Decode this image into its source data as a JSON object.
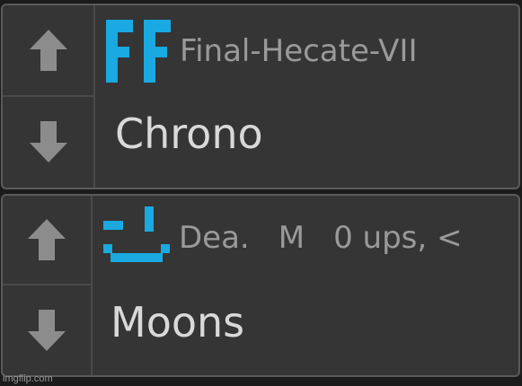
{
  "colors": {
    "background": "#1b1b1b",
    "card": "#353535",
    "border": "#5a5a5a",
    "arrow": "#8c8c8c",
    "logo": "#1aa9e0",
    "meta_text": "#9a9a9a",
    "title_text": "#d9d9d9"
  },
  "posts": [
    {
      "logo_icon": "ff-logo-icon",
      "author": "Final-Hecate-VII",
      "title": "Chrono"
    },
    {
      "logo_icon": "smiley-face-icon",
      "author": "Dea.",
      "flair": "M",
      "stats": "0 ups, <",
      "title": "Moons"
    }
  ],
  "watermark": "imgflip.com"
}
